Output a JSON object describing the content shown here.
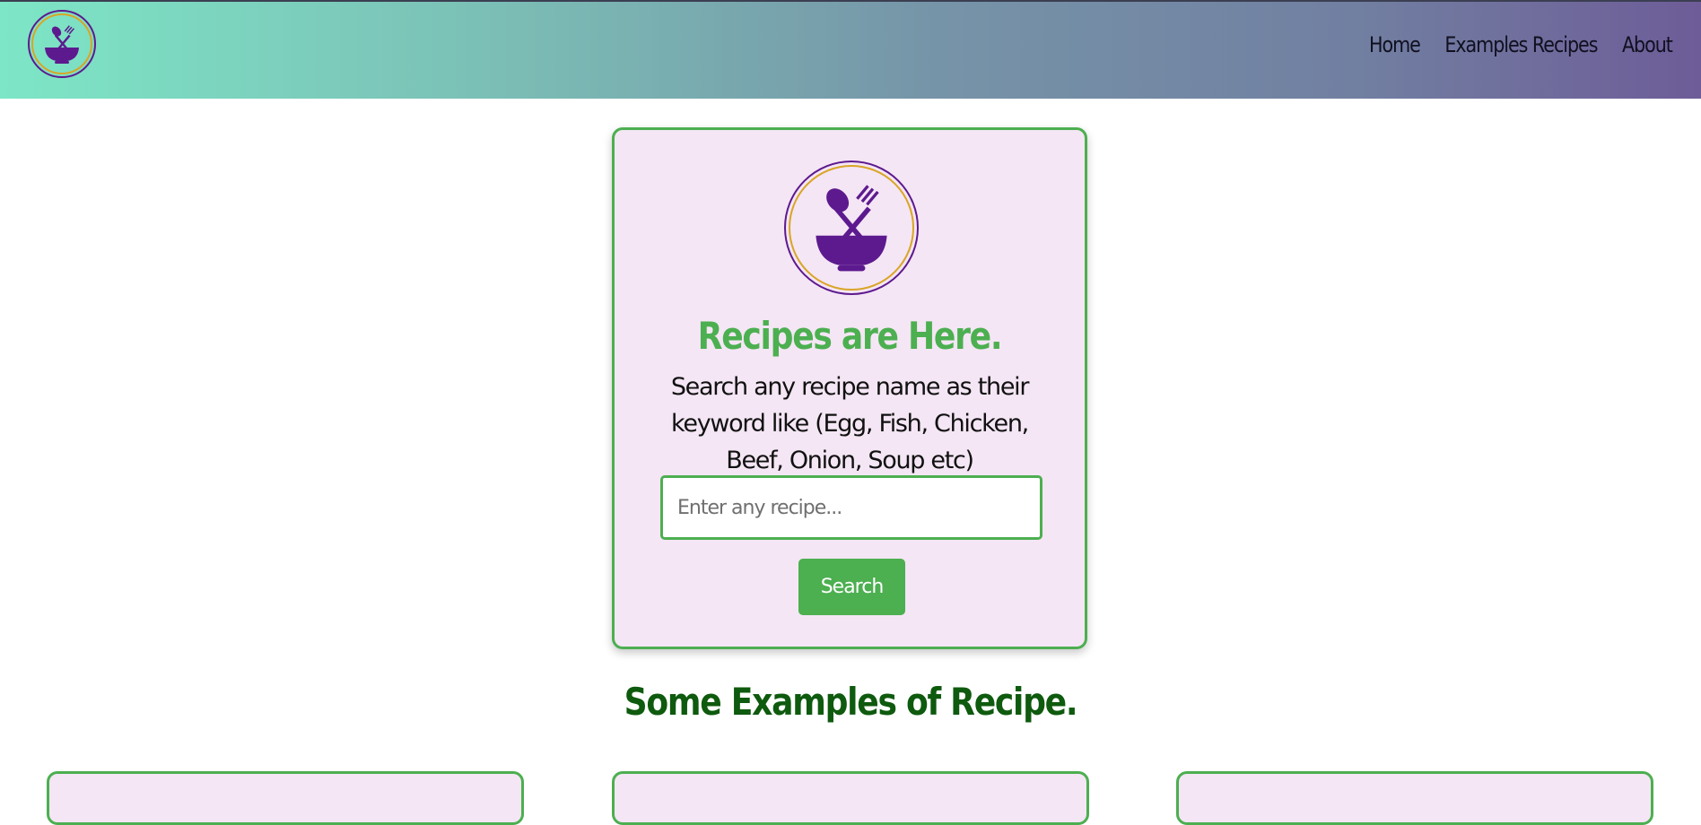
{
  "nav": {
    "logo_icon": "bowl-spoon-fork-icon",
    "links": [
      "Home",
      "Examples Recipes",
      "About"
    ]
  },
  "hero": {
    "logo_icon": "bowl-spoon-fork-icon",
    "title": "Recipes are Here.",
    "description": "Search any recipe name as their keyword like (Egg, Fish, Chicken, Beef, Onion, Soup etc)",
    "search_placeholder": "Enter any recipe...",
    "search_value": "",
    "search_button": "Search"
  },
  "examples": {
    "title": "Some Examples of Recipe."
  },
  "colors": {
    "accent_green": "#4caf50",
    "dark_green": "#0e5a0e",
    "card_bg": "#f4e6f4",
    "logo_purple": "#5d1a8f",
    "logo_gold": "#d9a526"
  }
}
